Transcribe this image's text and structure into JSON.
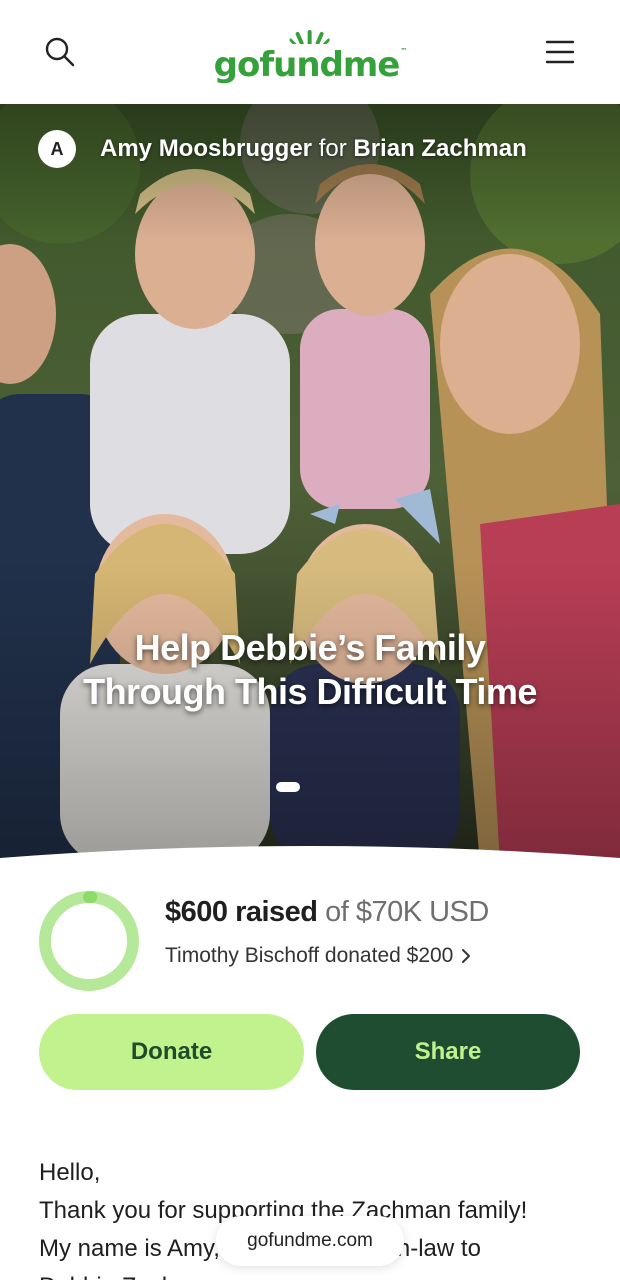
{
  "header": {
    "logo_text": "gofundme",
    "search_icon": "search-icon",
    "menu_icon": "menu-icon",
    "brand_color": "#35a13a"
  },
  "hero": {
    "avatar_initial": "A",
    "organizer_name": "Amy Moosbrugger",
    "organizer_for": "for",
    "beneficiary_name": "Brian Zachman",
    "title": "Help Debbie’s Family Through This Difficult Time"
  },
  "progress": {
    "amount_raised": "$600 raised",
    "goal": "of $70K USD",
    "fraction": 0.0086,
    "recent_donation": "Timothy Bischoff donated $200",
    "ring_color": "#8ddc6a",
    "ring_track_color": "#b6e89a"
  },
  "actions": {
    "donate_label": "Donate",
    "share_label": "Share",
    "donate_color": "#c2f28e",
    "share_color": "#1f4d31"
  },
  "story": {
    "line1": "Hello,",
    "line2": "Thank you for supporting the Zachman family!",
    "line3": "My name is Amy, Debbie’s sister-in-law to",
    "line4": "Debbie Zachman..."
  },
  "browser": {
    "url": "gofundme.com"
  }
}
